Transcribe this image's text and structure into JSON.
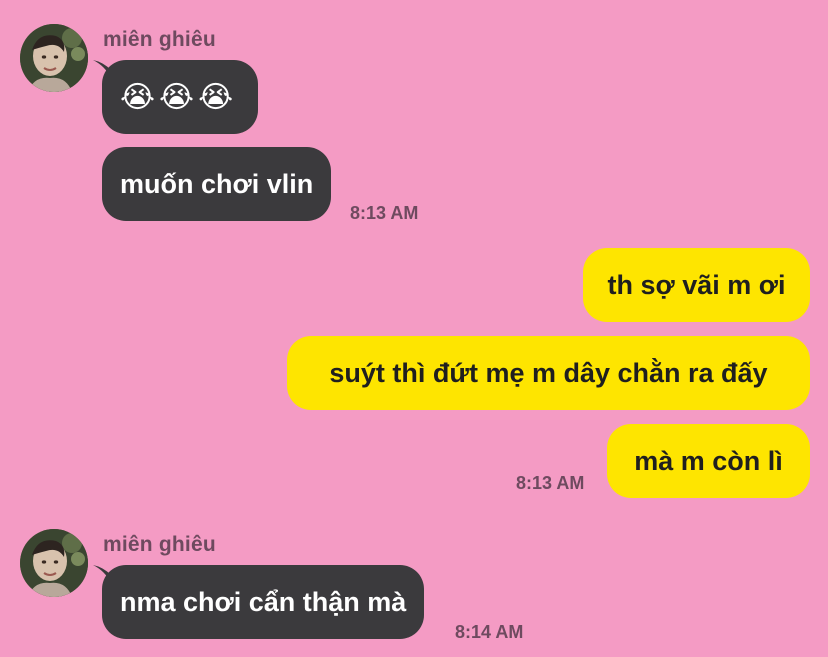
{
  "theme": {
    "background": "#f49bc4",
    "incoming_bubble": "#3b3a3d",
    "outgoing_bubble": "#fee500",
    "meta_text": "#6e4a5f"
  },
  "groups": [
    {
      "sender": "miên ghiêu",
      "avatar_icon": "user-avatar-photo",
      "messages": [
        "😭😭😭",
        "muốn chơi vlin"
      ],
      "time": "8:13 AM"
    },
    {
      "outgoing": true,
      "messages": [
        "th sợ vãi m ơi",
        "suýt thì đứt mẹ m dây chằn ra đấy",
        "mà m còn lì"
      ],
      "time": "8:13 AM"
    },
    {
      "sender": "miên ghiêu",
      "avatar_icon": "user-avatar-photo",
      "messages": [
        "nma chơi cẩn thận mà"
      ],
      "time": "8:14 AM"
    }
  ]
}
